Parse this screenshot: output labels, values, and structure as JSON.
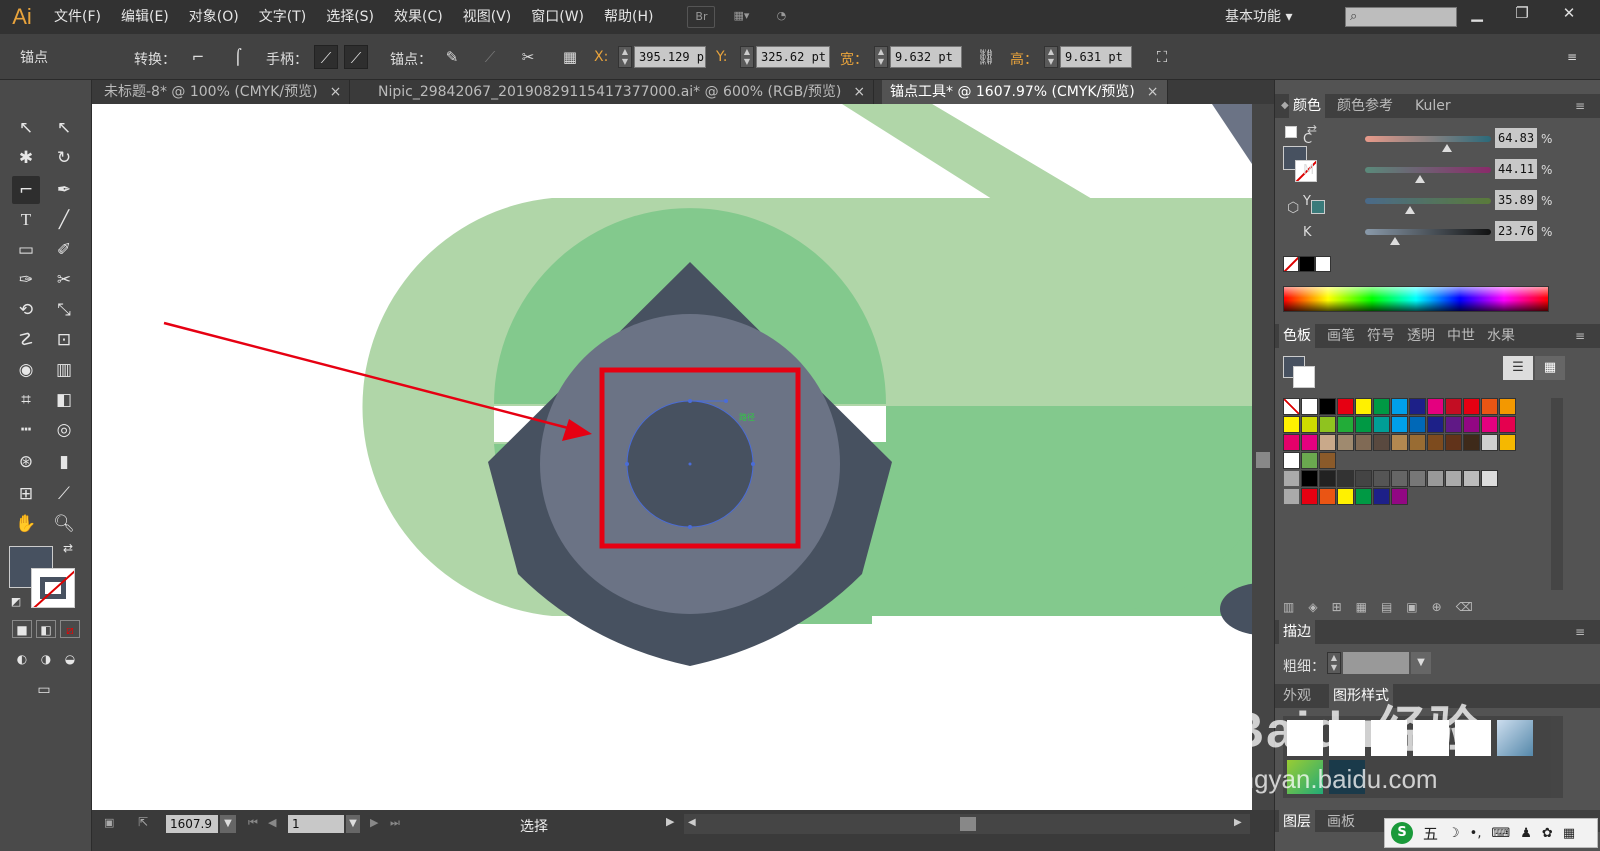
{
  "app": {
    "logo": "Ai"
  },
  "menu": [
    "文件(F)",
    "编辑(E)",
    "对象(O)",
    "文字(T)",
    "选择(S)",
    "效果(C)",
    "视图(V)",
    "窗口(W)",
    "帮助(H)"
  ],
  "menubar_icons": {
    "bridge": "Br"
  },
  "workspace_label": "基本功能",
  "window_buttons": {
    "minimize": "▁",
    "restore": "❐",
    "close": "✕"
  },
  "control": {
    "tool_name": "锚点",
    "convert_label": "转换：",
    "handle_label": "手柄：",
    "anchor_label": "锚点：",
    "x_label": "X:",
    "x_value": "395.129 p",
    "y_label": "Y:",
    "y_value": "325.62 pt",
    "w_label": "宽：",
    "w_value": "9.632 pt",
    "h_label": "高：",
    "h_value": "9.631 pt"
  },
  "tabs": [
    {
      "label": "未标题-8* @ 100% (CMYK/预览)",
      "close": "×",
      "active": false
    },
    {
      "label": "Nipic_29842067_20190829115417377000.ai* @ 600% (RGB/预览)",
      "close": "×",
      "active": false
    },
    {
      "label": "锚点工具* @ 1607.97% (CMYK/预览)",
      "close": "×",
      "active": true
    }
  ],
  "canvas": {
    "path_label": "路径"
  },
  "status": {
    "zoom": "1607.9",
    "artboard": "1",
    "mode": "选择"
  },
  "color_panel": {
    "tabs": [
      "颜色",
      "颜色参考",
      "Kuler"
    ],
    "channels": [
      {
        "name": "C",
        "value": "64.83",
        "level": 0.65,
        "unit": "%"
      },
      {
        "name": "M",
        "value": "44.11",
        "level": 0.44,
        "unit": "%"
      },
      {
        "name": "Y",
        "value": "35.89",
        "level": 0.36,
        "unit": "%"
      },
      {
        "name": "K",
        "value": "23.76",
        "level": 0.24,
        "unit": "%"
      }
    ]
  },
  "swatch_panel": {
    "tabs": [
      "色板",
      "画笔",
      "符号",
      "透明",
      "中世",
      "水果"
    ]
  },
  "stroke_panel": {
    "title": "描边",
    "weight_label": "粗细："
  },
  "appearance_panel": {
    "tabs": [
      "外观",
      "图形样式"
    ]
  },
  "bottom_tabs": [
    "图层",
    "画板"
  ],
  "watermark": {
    "brand": "Baidu经验",
    "url": "jingyan.baidu.com"
  },
  "ime_bar": {
    "logo": "S",
    "mode": "五"
  },
  "colors": {
    "accent_orange": "#e8a33c",
    "fill_dark": "#475160",
    "fill_mid": "#6b7385",
    "green_light": "#b0d6a8",
    "green_mid": "#83c98d",
    "highlight_red": "#e60012"
  }
}
